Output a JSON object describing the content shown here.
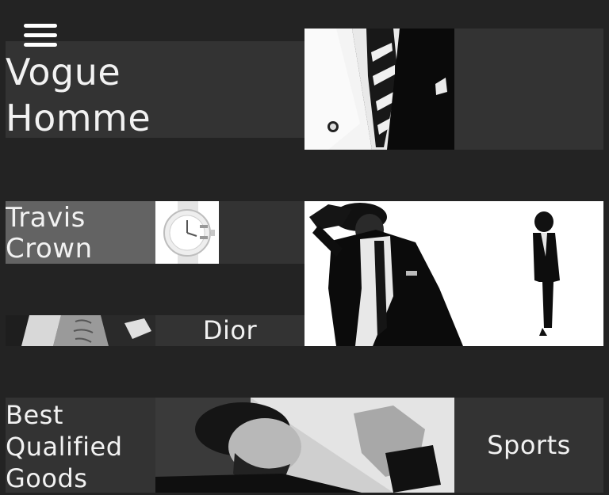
{
  "menu": {
    "icon": "hamburger-menu-icon"
  },
  "brand": {
    "line1": "Vogue",
    "line2": "Homme"
  },
  "tiles": {
    "travis_crown": {
      "line1": "Travis",
      "line2": "Crown"
    },
    "dior": {
      "label": "Dior"
    },
    "best_goods": {
      "line1": "Best",
      "line2": "Qualified",
      "line3": "Goods"
    },
    "sports": {
      "label": "Sports"
    }
  },
  "images": {
    "suit": "suit-closeup-photo",
    "watch": "white-watch-photo",
    "model": "suited-model-photo",
    "torso": "torso-photo",
    "portrait": "reclining-man-photo"
  },
  "colors": {
    "background": "#232323",
    "tile": "#333333",
    "tile_light": "#636363",
    "text": "#f2f2f2"
  }
}
